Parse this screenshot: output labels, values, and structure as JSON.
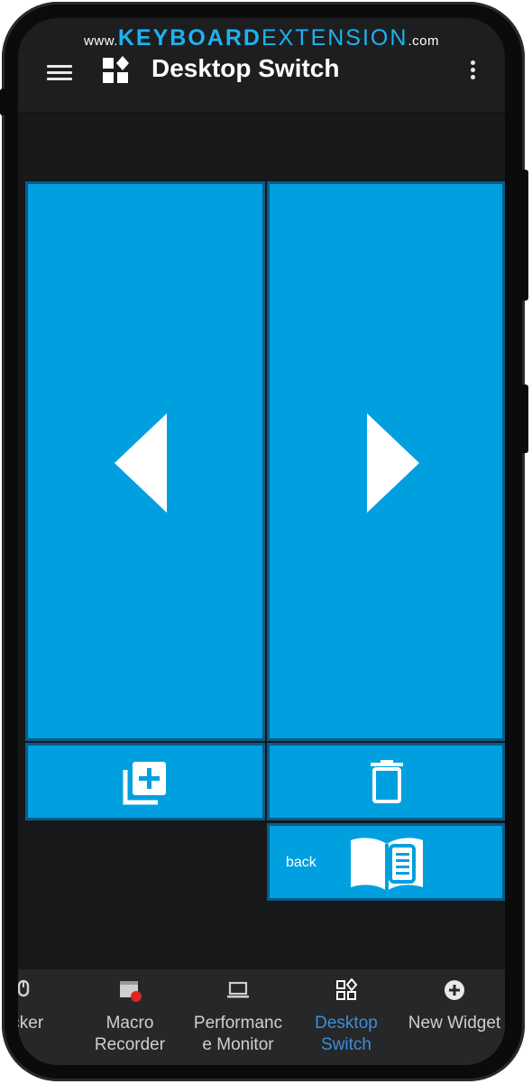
{
  "watermark": {
    "prefix": "www.",
    "brand_bold": "KEYBOARD",
    "brand_light": "EXTENSION",
    "suffix": ".com"
  },
  "appbar": {
    "title": "Desktop Switch"
  },
  "tiles": {
    "back_label": "back"
  },
  "bottom_nav": [
    {
      "label": "licker",
      "icon": "clicker-icon",
      "active": false
    },
    {
      "label": "Macro\nRecorder",
      "icon": "macro-recorder-icon",
      "active": false
    },
    {
      "label": "Performanc\ne Monitor",
      "icon": "laptop-icon",
      "active": false
    },
    {
      "label": "Desktop\nSwitch",
      "icon": "desktop-switch-icon",
      "active": true
    },
    {
      "label": "New Widget",
      "icon": "add-circle-icon",
      "active": false
    }
  ],
  "colors": {
    "tile": "#00a0e0",
    "tile_border": "#0a5c88",
    "active_nav": "#3a8fd8",
    "brand": "#1fb2f0"
  }
}
